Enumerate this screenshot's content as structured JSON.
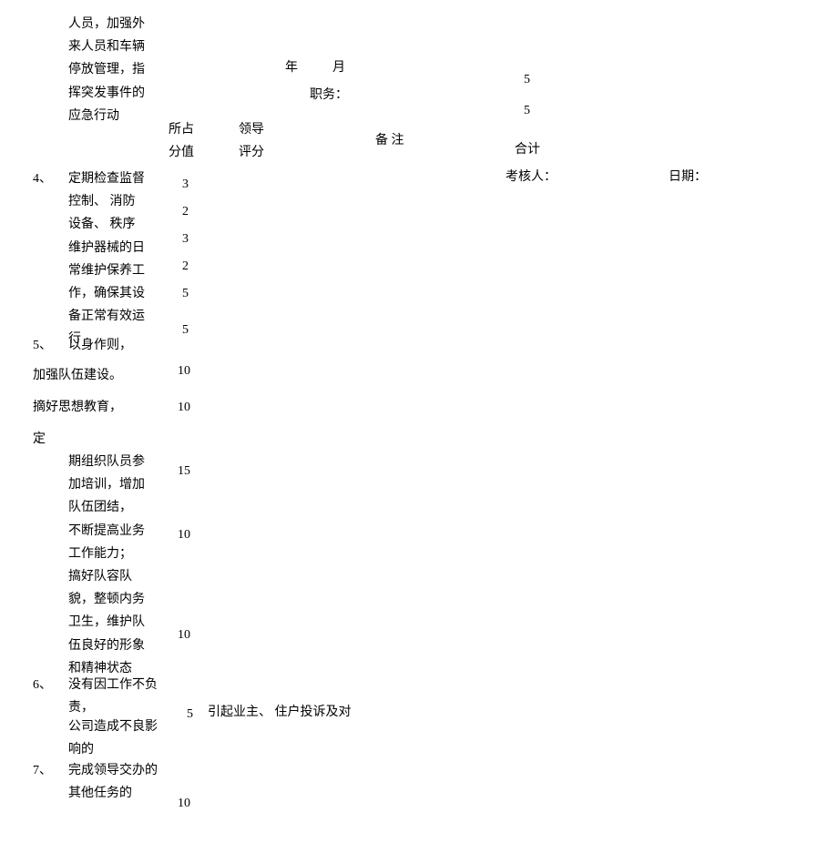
{
  "left_col": {
    "item_cont": "人员，加强外来人员和车辆停放管理，指挥突发事件的应急行动",
    "item4_num": "4、",
    "item4": "定期检查监督控制、 消防设备、 秩序维护器械的日常维护保养工作，确保其设备正常有效运行",
    "item5_num": "5、",
    "item5_a": "以身作则，",
    "item5_b": "加强队伍建设。",
    "item5_c": "摘好思想教育，",
    "item5_d": "定",
    "item5_e": "期组织队员参加培训，增加队伍团结， 不断提高业务工作能力； 搞好队容队貌，整顿内务卫生，维护队伍良好的形象和精神状态",
    "item6_num": "6、",
    "item6_a": "没有因工作不负责，",
    "item6_b": "引起业主、  住户投诉及对",
    "item6_c": "公司造成不良影响的",
    "item7_num": "7、",
    "item7": "完成领导交办的其他任务的"
  },
  "headers": {
    "suozhi": "所占",
    "fenzhi": "分值",
    "lingdao": "领导",
    "pingfen": "评分",
    "beizhu": "备 注"
  },
  "scores": {
    "s1": "3",
    "s2": "2",
    "s3": "3",
    "s4": "2",
    "s5": "5",
    "s6": "5",
    "s7": "10",
    "s8": "10",
    "s9": "15",
    "s10": "10",
    "s11": "10",
    "s12": "5",
    "s13": "10"
  },
  "right": {
    "year": "年",
    "month": "月",
    "zhiwu": "职务：",
    "val5a": "5",
    "val5b": "5",
    "heji": "合计",
    "kaoheren": "考核人：",
    "riqi": "日期："
  }
}
